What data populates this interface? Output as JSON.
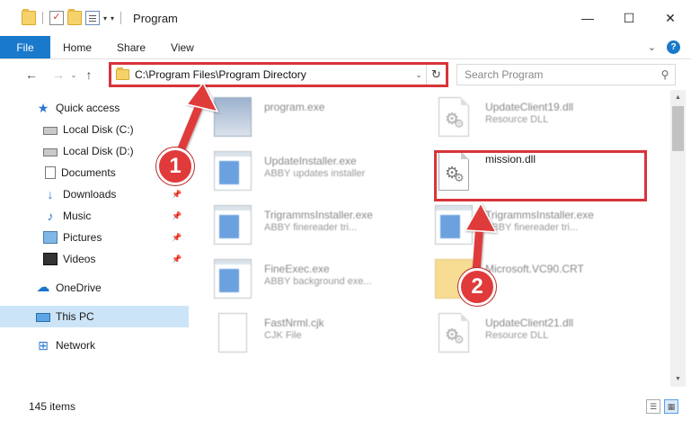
{
  "window": {
    "title": "Program",
    "controls": {
      "minimize": "—",
      "maximize": "☐",
      "close": "✕"
    }
  },
  "ribbon": {
    "tabs": [
      "File",
      "Home",
      "Share",
      "View"
    ]
  },
  "navigation": {
    "back": "←",
    "forward": "→",
    "up": "↑",
    "address": "C:\\Program Files\\Program Directory",
    "refresh": "↻",
    "search_placeholder": "Search Program"
  },
  "sidebar": {
    "items": [
      {
        "label": "Quick access",
        "icon": "star-icon"
      },
      {
        "label": "Local Disk (C:)",
        "icon": "drive-icon"
      },
      {
        "label": "Local Disk (D:)",
        "icon": "drive-icon"
      },
      {
        "label": "Documents",
        "icon": "documents-icon"
      },
      {
        "label": "Downloads",
        "icon": "downloads-icon"
      },
      {
        "label": "Music",
        "icon": "music-icon"
      },
      {
        "label": "Pictures",
        "icon": "pictures-icon"
      },
      {
        "label": "Videos",
        "icon": "videos-icon"
      },
      {
        "label": "OneDrive",
        "icon": "cloud-icon"
      },
      {
        "label": "This PC",
        "icon": "pc-icon"
      },
      {
        "label": "Network",
        "icon": "network-icon"
      }
    ]
  },
  "files": [
    {
      "name": "program.exe",
      "type": "",
      "icon": "setup-icon"
    },
    {
      "name": "UpdateClient19.dll",
      "type": "Resource DLL",
      "icon": "dll-icon"
    },
    {
      "name": "UpdateInstaller.exe",
      "type": "ABBY updates installer",
      "icon": "exe-icon"
    },
    {
      "name": "mission.dll",
      "type": "",
      "icon": "dll-icon"
    },
    {
      "name": "TrigrammsInstaller.exe",
      "type": "ABBY finereader tri...",
      "icon": "exe-icon"
    },
    {
      "name": "TrigrammsInstaller.exe",
      "type": "ABBY finereader tri...",
      "icon": "dll-icon"
    },
    {
      "name": "FineExec.exe",
      "type": "ABBY background exe...",
      "icon": "exe-icon"
    },
    {
      "name": "Microsoft.VC90.CRT",
      "type": "",
      "icon": "folder-icon"
    },
    {
      "name": "FastNrml.cjk",
      "type": "CJK File",
      "icon": "document-icon"
    },
    {
      "name": "UpdateClient21.dll",
      "type": "Resource DLL",
      "icon": "dll-icon"
    }
  ],
  "status": {
    "item_count": "145 items"
  },
  "annotations": {
    "step1": "1",
    "step2": "2",
    "highlight_color": "#d7343a"
  }
}
